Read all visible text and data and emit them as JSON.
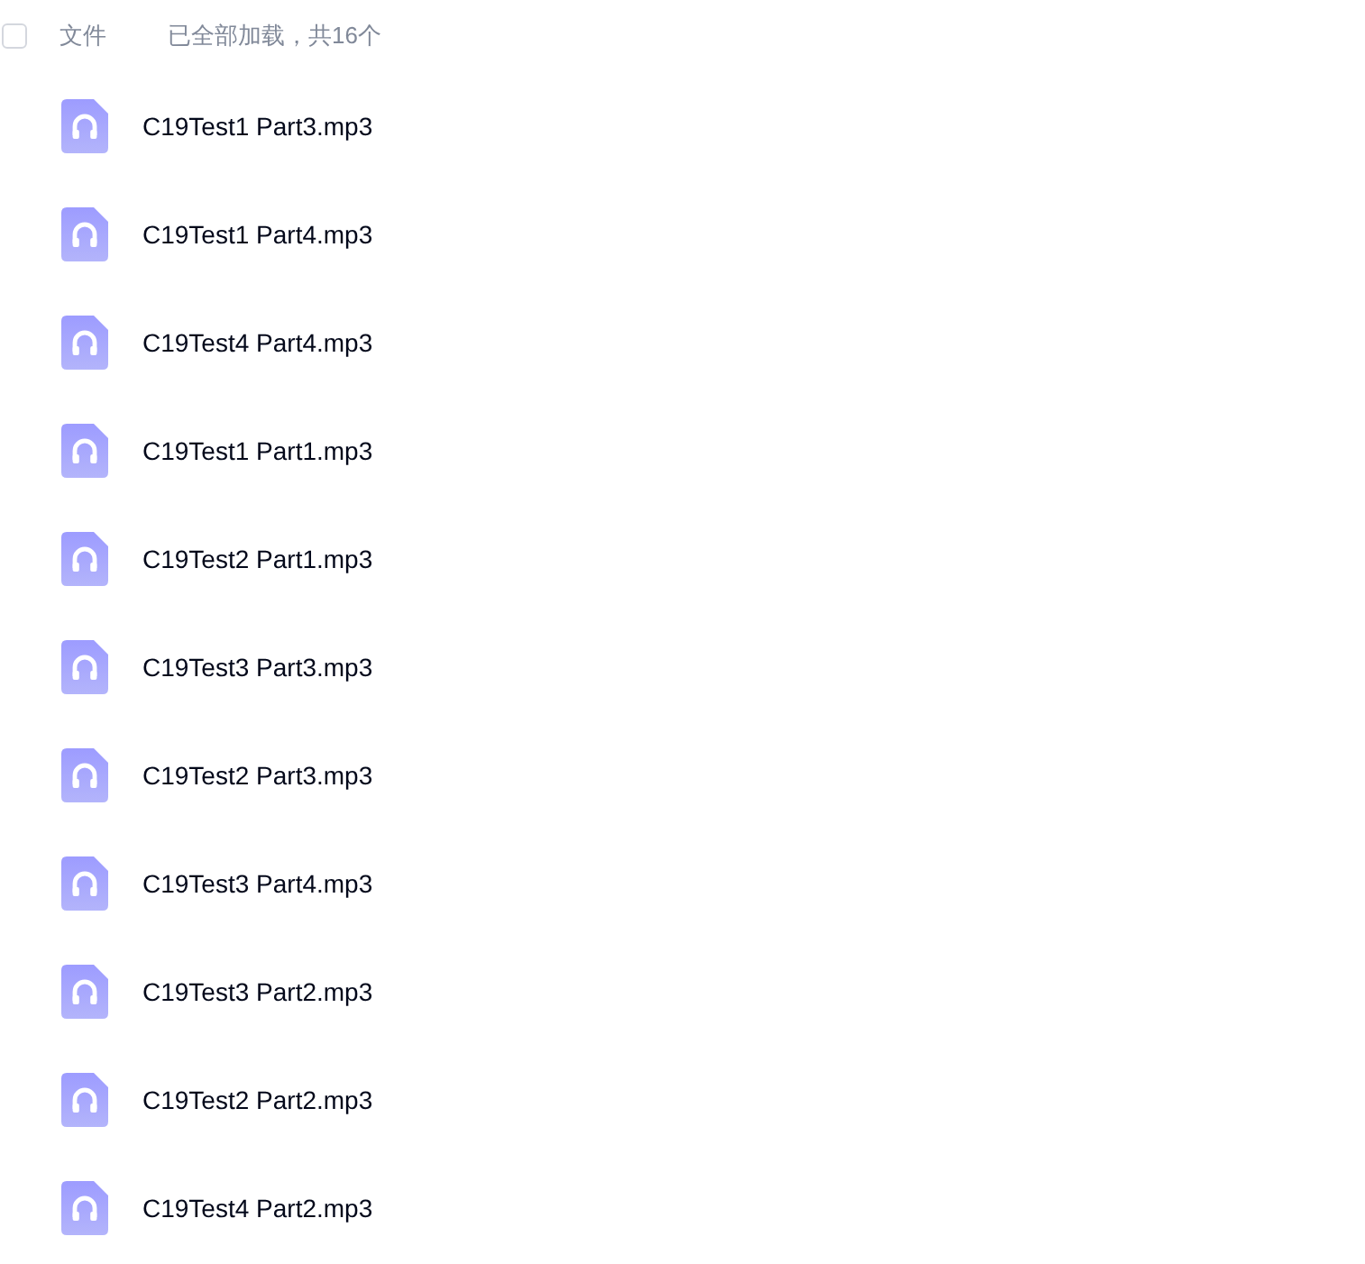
{
  "header": {
    "select_all": {
      "checked": false
    },
    "column_label": "文件",
    "status": "已全部加载，共16个"
  },
  "files": [
    {
      "name": "C19Test1 Part3.mp3"
    },
    {
      "name": "C19Test1 Part4.mp3"
    },
    {
      "name": "C19Test4 Part4.mp3"
    },
    {
      "name": "C19Test1 Part1.mp3"
    },
    {
      "name": "C19Test2 Part1.mp3"
    },
    {
      "name": "C19Test3 Part3.mp3"
    },
    {
      "name": "C19Test2 Part3.mp3"
    },
    {
      "name": "C19Test3 Part4.mp3"
    },
    {
      "name": "C19Test3 Part2.mp3"
    },
    {
      "name": "C19Test2 Part2.mp3"
    },
    {
      "name": "C19Test4 Part2.mp3"
    }
  ]
}
